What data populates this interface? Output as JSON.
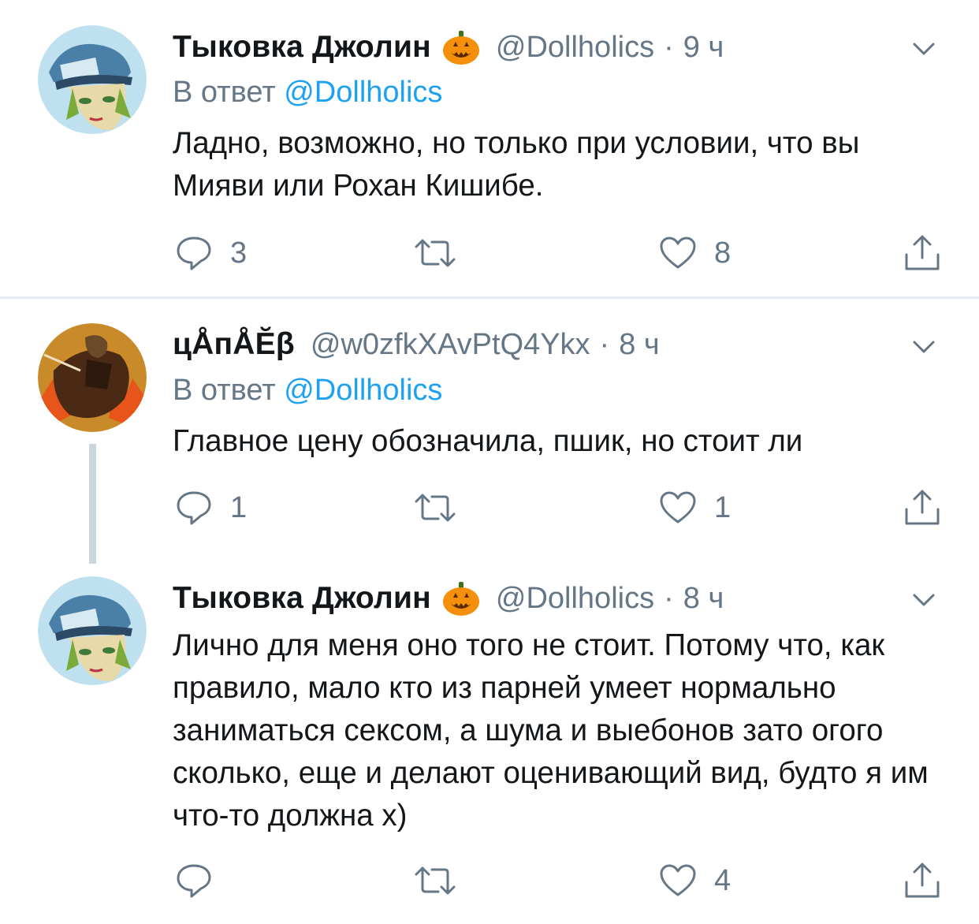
{
  "tweets": [
    {
      "name": "Тыковка Джолин",
      "handle": "@Dollholics",
      "dot": "·",
      "time": "9 ч",
      "reply_prefix": "В ответ",
      "reply_to": "@Dollholics",
      "text": "Ладно, возможно, но только при условии, что вы Мияви или Рохан Кишибе.",
      "replies": "3",
      "retweets": "",
      "likes": "8",
      "avatar_icon": "jolyne-avatar",
      "emoji_icon": "jack-o-lantern-icon"
    },
    {
      "name": "цÅпÅĔβ",
      "handle": "@w0zfkXAvPtQ4Ykx",
      "dot": "·",
      "time": "8 ч",
      "reply_prefix": "В ответ",
      "reply_to": "@Dollholics",
      "text": "Главное цену обозначила, пшик, но стоит ли",
      "replies": "1",
      "retweets": "",
      "likes": "1",
      "avatar_icon": "horse-rider-avatar"
    },
    {
      "name": "Тыковка Джолин",
      "handle": "@Dollholics",
      "dot": "·",
      "time": "8 ч",
      "text": "Лично для меня оно того не стоит. Потому что, как правило, мало кто из парней умеет нормально заниматься сексом, а шума и выебонов зато огого сколько, еще и делают оценивающий вид, будто я им что-то должна х)",
      "replies": "",
      "retweets": "",
      "likes": "4",
      "avatar_icon": "jolyne-avatar",
      "emoji_icon": "jack-o-lantern-icon"
    }
  ],
  "colors": {
    "text": "#14171a",
    "secondary": "#657786",
    "link": "#1da1f2",
    "divider": "#e6ecf0",
    "thread_line": "#ccd6dd",
    "pumpkin": "#f4900c"
  }
}
